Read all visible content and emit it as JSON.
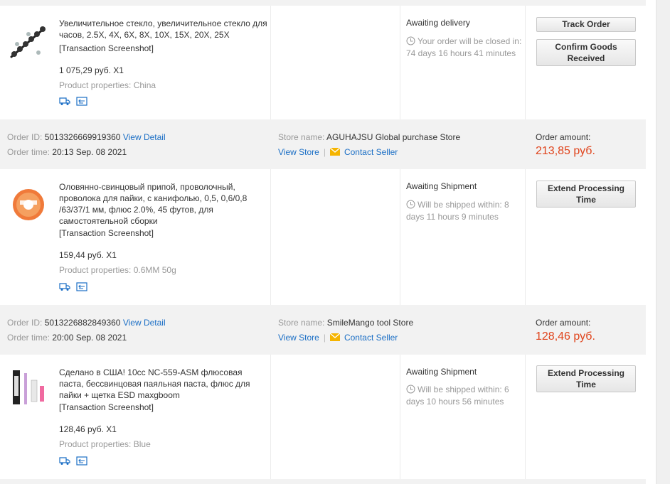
{
  "orders": [
    {
      "product": {
        "title": "Увеличительное стекло, увеличительное стекло для часов, 2.5X, 4X, 6X, 8X, 10X, 15X, 20X, 25X",
        "screenshot_link": "[Transaction Screenshot]",
        "price": "1 075,29 руб. X1",
        "properties": "Product properties: China"
      },
      "status": {
        "title": "Awaiting delivery",
        "detail": "Your order will be closed in: 74 days 16 hours 41 minutes"
      },
      "actions": [
        "Track Order",
        "Confirm Goods Received"
      ]
    },
    {
      "info": {
        "order_id_label": "Order ID:",
        "order_id": "5013326669919360",
        "view_detail": "View Detail",
        "order_time_label": "Order time:",
        "order_time": "20:13 Sep. 08 2021",
        "store_label": "Store name:",
        "store_name": "AGUHAJSU Global purchase Store",
        "view_store": "View Store",
        "contact_seller": "Contact Seller",
        "amount_label": "Order amount:",
        "amount": "213,85 руб."
      },
      "product": {
        "title": "Оловянно-свинцовый припой, проволочный, проволока для пайки, с канифолью, 0,5, 0,6/0,8 /63/37/1 мм, флюс 2.0%, 45 футов, для самостоятельной сборки",
        "screenshot_link": "[Transaction Screenshot]",
        "price": "159,44 руб. X1",
        "properties": "Product properties: 0.6MM 50g"
      },
      "status": {
        "title": "Awaiting Shipment",
        "detail": "Will be shipped within: 8 days 11 hours 9 minutes"
      },
      "actions": [
        "Extend Processing Time"
      ]
    },
    {
      "info": {
        "order_id_label": "Order ID:",
        "order_id": "5013226882849360",
        "view_detail": "View Detail",
        "order_time_label": "Order time:",
        "order_time": "20:00 Sep. 08 2021",
        "store_label": "Store name:",
        "store_name": "SmileMango tool Store",
        "view_store": "View Store",
        "contact_seller": "Contact Seller",
        "amount_label": "Order amount:",
        "amount": "128,46 руб."
      },
      "product": {
        "title": "Сделано в США! 10cc NC-559-ASM флюсовая паста, бессвинцовая паяльная паста, флюс для пайки + щетка ESD maxgboom",
        "screenshot_link": "[Transaction Screenshot]",
        "price": "128,46 руб. X1",
        "properties": "Product properties: Blue"
      },
      "status": {
        "title": "Awaiting Shipment",
        "detail": "Will be shipped within: 6 days 10 hours 56 minutes"
      },
      "actions": [
        "Extend Processing Time"
      ]
    }
  ],
  "colors": {
    "accent_link": "#1a6ec5",
    "amount": "#e0431b",
    "info_bg": "#f2f2f2",
    "muted_text": "#999999"
  },
  "icons": [
    "truck-icon",
    "receipt-icon",
    "clock-icon",
    "mail-icon"
  ]
}
